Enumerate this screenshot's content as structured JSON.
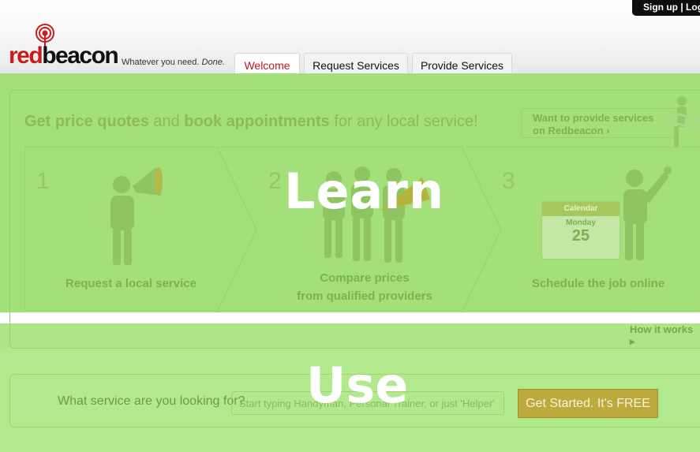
{
  "header": {
    "top_links": {
      "signup": "Sign up",
      "separator": " | ",
      "login": "Log in"
    },
    "logo": {
      "red": "red",
      "black": "beacon"
    },
    "tagline": {
      "main": "Whatever you need. ",
      "emph": "Done."
    },
    "tabs": [
      {
        "label": "Welcome",
        "active": true
      },
      {
        "label": "Request Services",
        "active": false
      },
      {
        "label": "Provide Services",
        "active": false
      }
    ]
  },
  "learn": {
    "overlay_label": "Learn",
    "headline": {
      "part1": "Get price quotes",
      "part2": " and ",
      "part3": "book appointments",
      "part4": " for any local service!"
    },
    "provider_promo": {
      "line1": "Want to provide services",
      "line2": "on Redbeacon",
      "arrow": "›"
    },
    "steps": [
      {
        "number": "1",
        "caption_line1": "Request a local service",
        "caption_line2": ""
      },
      {
        "number": "2",
        "caption_line1": "Compare prices",
        "caption_line2": "from qualified providers"
      },
      {
        "number": "3",
        "caption_line1": "Schedule the job online",
        "caption_line2": ""
      }
    ],
    "calendar": {
      "header": "Calendar",
      "day": "Monday",
      "date": "25"
    },
    "how_it_works": "How it works ▸"
  },
  "use": {
    "overlay_label": "Use",
    "search_label": "What service are you looking for?",
    "search_placeholder": "Start typing Handyman, Personal Trainer, or just 'Helper'",
    "button_label": "Get Started. It's FREE"
  },
  "colors": {
    "overlay_green": "#a4e07a",
    "brand_red": "#cc1b1b",
    "button_gold": "#bcab3c"
  }
}
